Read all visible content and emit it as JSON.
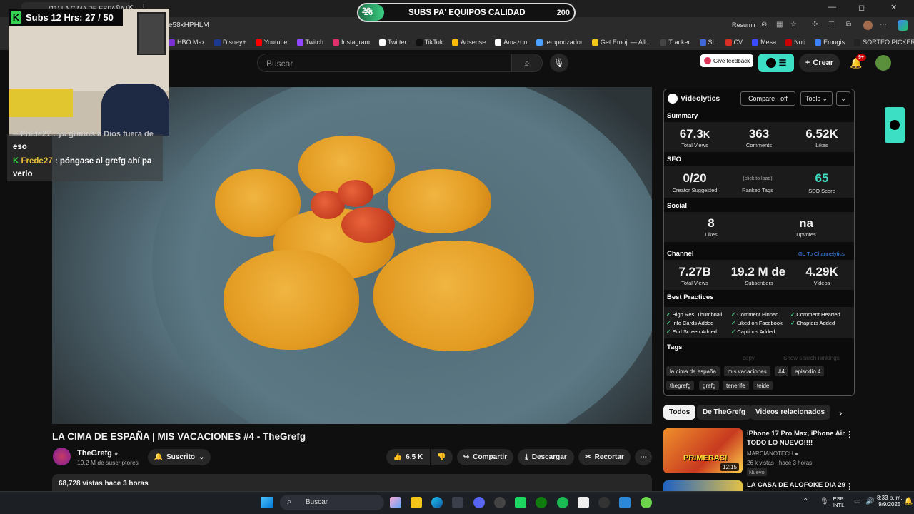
{
  "browser": {
    "tab_title": "(11) LA CIMA DE ESPAÑA |",
    "url": "e58xHPHLM",
    "resumir": "Resumir",
    "bookmarks": [
      {
        "label": "HBO Max",
        "color": "#7b2fd1"
      },
      {
        "label": "Disney+",
        "color": "#1a3a8f"
      },
      {
        "label": "Youtube",
        "color": "#ff0000"
      },
      {
        "label": "Twitch",
        "color": "#9146ff"
      },
      {
        "label": "Instagram",
        "color": "#e1306c"
      },
      {
        "label": "Twitter",
        "color": "#ffffff"
      },
      {
        "label": "TikTok",
        "color": "#111111"
      },
      {
        "label": "Adsense",
        "color": "#fbbc05"
      },
      {
        "label": "Amazon",
        "color": "#ffffff"
      },
      {
        "label": "temporizador",
        "color": "#4da3ff"
      },
      {
        "label": "Get Emoji — All...",
        "color": "#f5c518"
      },
      {
        "label": "Tracker",
        "color": "#444444"
      },
      {
        "label": "SL",
        "color": "#3d6ad6"
      },
      {
        "label": "CV",
        "color": "#d93025"
      },
      {
        "label": "Mesa",
        "color": "#3c4cff"
      },
      {
        "label": "Noti",
        "color": "#cc0000"
      },
      {
        "label": "Emogis",
        "color": "#3b82f6"
      },
      {
        "label": "SORTEO PICKER",
        "color": "#222222"
      }
    ]
  },
  "overlay": {
    "subs_counter": "Subs 12 Hrs: 27 / 50",
    "goal_start": "26",
    "goal_title": "SUBS PA' EQUIPOS CALIDAD",
    "goal_end": "200",
    "goal_progress_fraction": 0.01,
    "chat_partial": "—Frede27 : ya granos a Dios fuera de",
    "chat": [
      {
        "text_1": "eso"
      },
      {
        "nick": "Frede27",
        "text": " : póngase al grefg ahí pa",
        "text_2": "verlo"
      }
    ]
  },
  "youtube": {
    "search_placeholder": "Buscar",
    "feedback": "Give feedback",
    "create": "Crear",
    "notifications": "9+",
    "video_title": "LA CIMA DE ESPAÑA | MIS VACACIONES #4 - TheGrefg",
    "channel_name": "TheGrefg",
    "channel_subs": "19.2 M de suscriptores",
    "subscribed": "Suscrito",
    "likes": "6.5 K",
    "share": "Compartir",
    "download": "Descargar",
    "clip": "Recortar",
    "views_meta": "68,728 vistas  hace 3 horas"
  },
  "videolytics": {
    "brand": "Videolytics",
    "compare": "Compare - off",
    "tools": "Tools",
    "summary_title": "Summary",
    "summary": [
      {
        "value": "67.3",
        "unit": "K",
        "label": "Total Views"
      },
      {
        "value": "363",
        "unit": "",
        "label": "Comments"
      },
      {
        "value": "6.52K",
        "unit": "",
        "label": "Likes"
      }
    ],
    "seo_title": "SEO",
    "seo_suggested": "0/20",
    "seo_suggested_label": "Creator Suggested",
    "seo_click": "(click to load)",
    "seo_ranked": "Ranked Tags",
    "seo_score": "65",
    "seo_score_label": "SEO Score",
    "social_title": "Social",
    "social_likes": "8",
    "social_likes_label": "Likes",
    "social_upvotes": "na",
    "social_upvotes_label": "Upvotes",
    "channel_title": "Channel",
    "channel_link": "Go To Channelytics",
    "channel_stats": [
      {
        "value": "7.27B",
        "label": "Total Views"
      },
      {
        "value": "19.2 M de",
        "label": "Subscribers"
      },
      {
        "value": "4.29K",
        "label": "Videos"
      }
    ],
    "bp_title": "Best Practices",
    "best_practices": [
      "High Res. Thumbnail",
      "Comment Pinned",
      "Comment Hearted",
      "Info Cards Added",
      "Liked on Facebook",
      "Chapters Added",
      "End Screen Added",
      "Captions Added"
    ],
    "tags_title": "Tags",
    "tags_copy": "copy",
    "tags_show": "Show search rankings",
    "tags": [
      "la cima de españa",
      "mis vacaciones",
      "#4",
      "episodio 4",
      "thegrefg",
      "grefg",
      "tenerife",
      "teide"
    ]
  },
  "related": {
    "chips": [
      "Todos",
      "De TheGrefg",
      "Videos relacionados"
    ],
    "items": [
      {
        "title_1": "iPhone 17 Pro Max, iPhone Air",
        "title_2": "TODO LO NUEVO!!!!",
        "channel": "MARCIANOTECH",
        "meta": "26 k vistas · hace 3 horas",
        "badge": "Nuevo",
        "duration": "12:15",
        "thumb_text": "PRIMERAS!"
      },
      {
        "title_1": "LA CASA DE ALOFOKE DIA 29"
      }
    ]
  },
  "taskbar": {
    "search": "Buscar",
    "lang_1": "ESP",
    "lang_2": "INTL",
    "time": "8:33 p. m.",
    "date": "9/9/2025"
  }
}
